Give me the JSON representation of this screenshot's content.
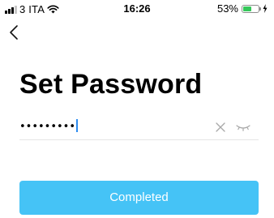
{
  "status_bar": {
    "carrier": "3 ITA",
    "time": "16:26",
    "battery_percent": "53%",
    "battery_level": 0.53,
    "battery_color": "#34c759",
    "icons": [
      "signal-icon",
      "wifi-icon",
      "battery-icon",
      "charging-bolt-icon"
    ]
  },
  "nav": {
    "back_icon": "chevron-left-icon"
  },
  "title": "Set Password",
  "password": {
    "value": "•••••••••",
    "clear_icon": "close-icon",
    "visibility_icon": "eye-closed-icon"
  },
  "primary_button": {
    "label": "Completed",
    "color": "#45c3f6"
  }
}
